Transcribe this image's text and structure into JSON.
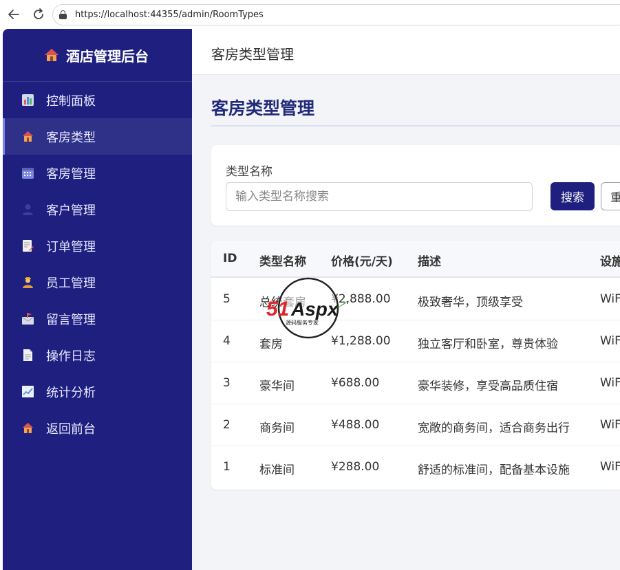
{
  "browser": {
    "url": "https://localhost:44355/admin/RoomTypes"
  },
  "sidebar": {
    "brand": "酒店管理后台",
    "items": [
      {
        "label": "控制面板",
        "icon": "bar-chart-icon"
      },
      {
        "label": "客房类型",
        "icon": "house-icon",
        "active": true
      },
      {
        "label": "客房管理",
        "icon": "calendar-icon"
      },
      {
        "label": "客户管理",
        "icon": "user-icon"
      },
      {
        "label": "订单管理",
        "icon": "memo-icon"
      },
      {
        "label": "员工管理",
        "icon": "worker-icon"
      },
      {
        "label": "留言管理",
        "icon": "mailbox-icon"
      },
      {
        "label": "操作日志",
        "icon": "document-icon"
      },
      {
        "label": "统计分析",
        "icon": "line-chart-icon"
      },
      {
        "label": "返回前台",
        "icon": "house-icon"
      }
    ]
  },
  "header": {
    "title": "客房类型管理"
  },
  "main": {
    "page_title": "客房类型管理",
    "search": {
      "label": "类型名称",
      "placeholder": "输入类型名称搜索",
      "search_label": "搜索",
      "reset_label": "重"
    },
    "table": {
      "columns": [
        "ID",
        "类型名称",
        "价格(元/天)",
        "描述",
        "设施"
      ],
      "rows": [
        {
          "id": "5",
          "name": "总统套房",
          "price": "¥2,888.00",
          "description": "极致奢华，顶级享受",
          "facilities": "WiF"
        },
        {
          "id": "4",
          "name": "套房",
          "price": "¥1,288.00",
          "description": "独立客厅和卧室，尊贵体验",
          "facilities": "WiF"
        },
        {
          "id": "3",
          "name": "豪华间",
          "price": "¥688.00",
          "description": "豪华装修，享受高品质住宿",
          "facilities": "WiF"
        },
        {
          "id": "2",
          "name": "商务间",
          "price": "¥488.00",
          "description": "宽敞的商务间，适合商务出行",
          "facilities": "WiF"
        },
        {
          "id": "1",
          "name": "标准间",
          "price": "¥288.00",
          "description": "舒适的标准间，配备基本设施",
          "facilities": "WiF"
        }
      ]
    }
  },
  "watermark": {
    "logo": "51Aspx",
    "tagline": "源码服务专家"
  },
  "colors": {
    "sidebar": "#1e1f7e",
    "accent": "#222a7a",
    "background": "#f3f4f7"
  }
}
